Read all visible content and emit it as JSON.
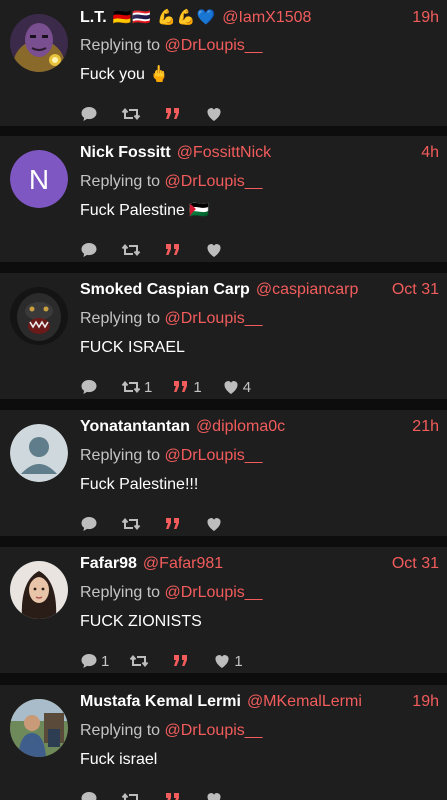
{
  "colors": {
    "background": "#0d0d0d",
    "card": "#1e1e1e",
    "accent": "#f25c5c",
    "muted": "#c4c4c4",
    "icon": "#bdbdbd"
  },
  "reply_prefix": "Replying to",
  "replies": [
    {
      "name": "L.T.",
      "badges": "🇩🇪🇹🇭 💪💪💙",
      "handle": "@IamX1508",
      "time": "19h",
      "replying_to": "@DrLoupis__",
      "text": "Fuck you 🖕",
      "counts": {
        "comments": "",
        "retweets": "",
        "quotes": "",
        "likes": ""
      },
      "avatar": {
        "type": "image",
        "icon": "villain-portrait-icon"
      }
    },
    {
      "name": "Nick Fossitt",
      "badges": "",
      "handle": "@FossittNick",
      "time": "4h",
      "replying_to": "@DrLoupis__",
      "text": "Fuck Palestine 🇵🇸",
      "counts": {
        "comments": "",
        "retweets": "",
        "quotes": "",
        "likes": ""
      },
      "avatar": {
        "type": "letter",
        "letter": "N",
        "color": "#7e57c2"
      }
    },
    {
      "name": "Smoked Caspian Carp",
      "badges": "",
      "handle": "@caspiancarp",
      "time": "Oct 31",
      "replying_to": "@DrLoupis__",
      "text": "FUCK ISRAEL",
      "counts": {
        "comments": "",
        "retweets": "1",
        "quotes": "1",
        "likes": "4"
      },
      "avatar": {
        "type": "image",
        "icon": "gorilla-portrait-icon"
      }
    },
    {
      "name": "Yonatantantan",
      "badges": "",
      "handle": "@diploma0c",
      "time": "21h",
      "replying_to": "@DrLoupis__",
      "text": "Fuck Palestine!!!",
      "counts": {
        "comments": "",
        "retweets": "",
        "quotes": "",
        "likes": ""
      },
      "avatar": {
        "type": "default",
        "icon": "default-user-icon"
      }
    },
    {
      "name": "Fafar98",
      "badges": "",
      "handle": "@Fafar981",
      "time": "Oct 31",
      "replying_to": "@DrLoupis__",
      "text": "FUCK ZIONISTS",
      "counts": {
        "comments": "1",
        "retweets": "",
        "quotes": "",
        "likes": "1"
      },
      "avatar": {
        "type": "image",
        "icon": "woman-portrait-icon"
      }
    },
    {
      "name": "Mustafa Kemal Lermi",
      "badges": "",
      "handle": "@MKemalLermi",
      "time": "19h",
      "replying_to": "@DrLoupis__",
      "text": "Fuck israel",
      "counts": {
        "comments": "",
        "retweets": "",
        "quotes": "",
        "likes": ""
      },
      "avatar": {
        "type": "image",
        "icon": "outdoor-photo-icon"
      }
    }
  ]
}
